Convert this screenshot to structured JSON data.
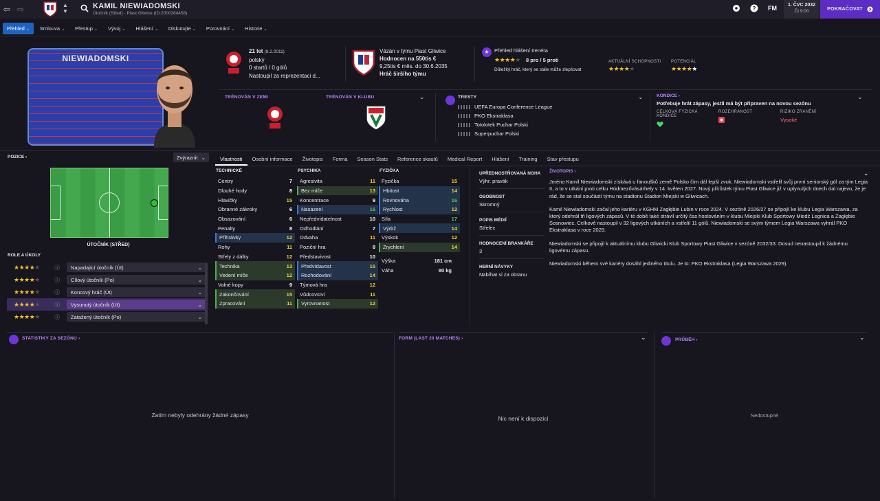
{
  "topbar": {
    "player_name": "KAMIL NIEWIADOMSKI",
    "player_sub": "Útočník (Střed) - Piast Gliwice (ID:2000284458)",
    "fm_label": "FM",
    "date_line1": "1. ČVC 2032",
    "date_line2": "Čt 9:00",
    "continue_label": "POKRAČOVAT"
  },
  "menu": {
    "items": [
      "Přehled",
      "Smlouva",
      "Přestup",
      "Vývoj",
      "Hlášení",
      "Diskutujte",
      "Porovnání",
      "Historie"
    ]
  },
  "kit": {
    "name": "NIEWIADOMSKI"
  },
  "bio": {
    "age": "21 let",
    "dob": "(8.2.2011)",
    "nationality": "polský",
    "caps": "0 startů / 0 gólů",
    "debut": "Nastoupil za reprezentaci d..."
  },
  "contract": {
    "club_line": "Vázán v týmu Piast Gliwice",
    "value": "Hodnocen na 550tis €",
    "wage": "9,25tis € měs. do 30.6.2035",
    "status": "Hráč širšího týmu"
  },
  "scout": {
    "title": "Přehled hlášení trenéra",
    "proscons": "8 pro / 5 proti",
    "note": "Důležitý hráč, který se stále může zlepšovat",
    "current_label": "AKTUÁLNÍ SCHOPNOSTI",
    "potential_label": "POTENCIÁL"
  },
  "trained": {
    "nation_label": "TRÉNOVÁN V ZEMI",
    "club_label": "TRÉNOVÁN V KLUBU"
  },
  "trophies": {
    "title": "TRESTY",
    "items": [
      "UEFA Europa Conference League",
      "PKO Ekstraklasa",
      "Totolotek Puchar Polski",
      "Superpuchar Polski"
    ]
  },
  "condition": {
    "title": "KONDICE",
    "message": "Potřebuje hrát zápasy, jestli má být připraven na novou sezónu",
    "fitness_label": "CELKOVÁ FYZICKÁ KONDICE",
    "sharpness_label": "ROZEHRANOST",
    "injury_label": "RIZIKO ZRANĚNÍ",
    "injury_value": "Vysoké"
  },
  "position": {
    "title": "POZICE",
    "highlight_label": "Zvýraznit",
    "position_name": "ÚTOČNÍK (STŘED)",
    "roles_title": "ROLE A ÚKOLY",
    "roles": [
      {
        "name": "Napadající útočník (Út)",
        "stars": 3.5
      },
      {
        "name": "Cílový útočník (Po)",
        "stars": 3.5
      },
      {
        "name": "Koncový hráč (Út)",
        "stars": 3.5
      },
      {
        "name": "Vysunutý útočník (Út)",
        "stars": 3.5
      },
      {
        "name": "Zatažený útočník (Po)",
        "stars": 3.5
      }
    ]
  },
  "tabs": [
    "Vlastnosti",
    "Osobní informace",
    "Životopis",
    "Forma",
    "Season Stats",
    "Reference skautů",
    "Medical Report",
    "Hlášení",
    "Training",
    "Stav přestupu"
  ],
  "attributes": {
    "technical": {
      "title": "TECHNICKÉ",
      "rows": [
        [
          "Centry",
          7,
          ""
        ],
        [
          "Dlouhé hody",
          8,
          ""
        ],
        [
          "Hlavičky",
          15,
          ""
        ],
        [
          "Obranné zákroky",
          6,
          ""
        ],
        [
          "Obsazování",
          6,
          ""
        ],
        [
          "Penalty",
          8,
          ""
        ],
        [
          "Přihrávky",
          12,
          "b"
        ],
        [
          "Rohy",
          11,
          ""
        ],
        [
          "Střely z dálky",
          12,
          ""
        ],
        [
          "Technika",
          13,
          "g"
        ],
        [
          "Vedení míče",
          12,
          "g"
        ],
        [
          "Volné kopy",
          9,
          ""
        ],
        [
          "Zakončování",
          15,
          "g"
        ],
        [
          "Zpracování",
          11,
          "g"
        ]
      ]
    },
    "mental": {
      "title": "PSYCHIKA",
      "rows": [
        [
          "Agresivita",
          11,
          ""
        ],
        [
          "Bez míče",
          13,
          "g"
        ],
        [
          "Koncentrace",
          9,
          ""
        ],
        [
          "Nasazení",
          16,
          "b"
        ],
        [
          "Nepředvídatelnost",
          10,
          ""
        ],
        [
          "Odhodlání",
          7,
          ""
        ],
        [
          "Odvaha",
          11,
          ""
        ],
        [
          "Poziční hra",
          8,
          ""
        ],
        [
          "Představivost",
          10,
          ""
        ],
        [
          "Předvídavost",
          15,
          "b"
        ],
        [
          "Rozhodování",
          14,
          "b"
        ],
        [
          "Týmová hra",
          12,
          ""
        ],
        [
          "Vůdcovství",
          11,
          ""
        ],
        [
          "Vyrovnanost",
          12,
          "g"
        ]
      ]
    },
    "physical": {
      "title": "FYZIČKA",
      "rows": [
        [
          "Fyzička",
          15,
          ""
        ],
        [
          "Hbitost",
          14,
          "b"
        ],
        [
          "Rovnováha",
          16,
          "b"
        ],
        [
          "Rychlost",
          12,
          "b"
        ],
        [
          "Síla",
          17,
          ""
        ],
        [
          "Výdrž",
          14,
          "b"
        ],
        [
          "Výskok",
          12,
          ""
        ],
        [
          "Zrychlení",
          14,
          "g"
        ]
      ],
      "height_label": "Výška",
      "height": "181 cm",
      "weight_label": "Váha",
      "weight": "80 kg"
    }
  },
  "extra": {
    "foot_label": "UPŘEDNOSTŇOVANÁ NOHA",
    "foot": "Výhr. pravák",
    "personality_label": "OSOBNOST",
    "personality": "Skromný",
    "media_label": "POPIS MÉDIÍ",
    "media": "Střelec",
    "gk_label": "HODNOCENÍ BRANKÁŘE",
    "gk": "3",
    "habits_label": "HERNÍ NÁVYKY",
    "habits": "Nabíhat si za obranu"
  },
  "biography": {
    "title": "ŽIVOTOPIS",
    "p1": "Jméno Kamil Niewiadomski získává u fanoušků země Polsko čím dál lepší zvuk. Niewiadomski vstřelil svůj první seniorský gól za tým Legia II, a to v utkání proti celku Hódmezővásárhely v 14. květen 2027. Nový přírůstek týmu Piast Gliwice již v uplynulých dnech dal najevo, že je rád, že se stal součástí týmu na stadionu Stadion Miejski w Gliwicach.",
    "p2": "Kamil Niewiadomski začal jeho kariéru v KGHM Zagłębie Lubin v roce 2024. V sezóně 2026/27 se připojil ke klubu Legia Warszawa, za který odehrál tři ligových zápasů. V té době také strávil určitý čas hostováním v klubu Miejski Klub Sportowy Miedź Legnica a Zagłębie Sosnowiec. Celkově nastoupil v 32 ligových utkáních a vstřelil 11 gólů. Niewiadomski se svým týmem Legia Warszawa vyhrál PKO Ekstraklasa v roce 2029.",
    "p3": "Niewiadomski se připojil k aktuálnímu klubu Gliwicki Klub Sportowy Piast Gliwice v sezóně 2032/33. Dosud nenastoupil k žádnému ligovému zápasu.",
    "p4": "Niewiadomski během své kariéry dosáhl jediného titulu. Je to: PKO Ekstraklasa (Legia Warszawa 2029)."
  },
  "panels": {
    "stats_title": "STATISTIKY ZA SEZÓNU",
    "stats_empty": "Zatím nebyly odehrány žádné zápasy",
    "form_title": "FORM (LAST 20 MATCHES)",
    "form_empty": "Nic není k dispozici",
    "progress_title": "PRŮBĚH",
    "progress_empty": "Nedostupné"
  },
  "colors": {
    "accent": "#5b2dc2",
    "menu_active": "#1e63c4",
    "bg": "#17151d"
  }
}
